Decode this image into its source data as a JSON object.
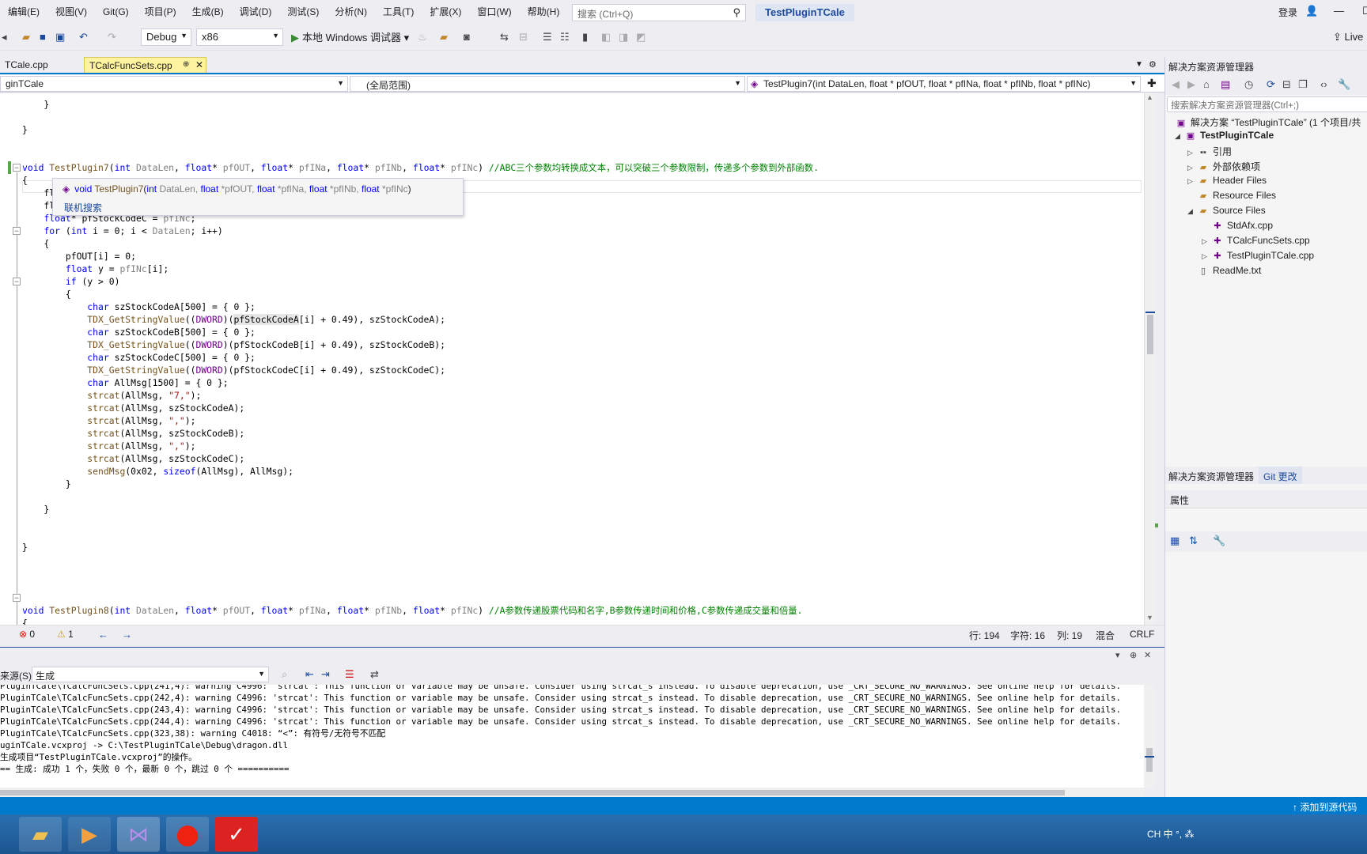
{
  "menu": [
    "编辑(E)",
    "视图(V)",
    "Git(G)",
    "项目(P)",
    "生成(B)",
    "调试(D)",
    "测试(S)",
    "分析(N)",
    "工具(T)",
    "扩展(X)",
    "窗口(W)",
    "帮助(H)"
  ],
  "search": {
    "placeholder": "搜索 (Ctrl+Q)"
  },
  "solution_title": "TestPluginTCale",
  "login": "登录",
  "toolbar": {
    "config": "Debug",
    "platform": "x86",
    "run_label": "本地 Windows 调试器",
    "live_share": "Live"
  },
  "tabs": [
    {
      "label": "TCale.cpp"
    },
    {
      "label": "TCalcFuncSets.cpp"
    }
  ],
  "nav": {
    "project": "ginTCale",
    "scope": "(全局范围)",
    "member": "TestPlugin7(int DataLen, float * pfOUT, float * pfINa, float * pfINb, float * pfINc)"
  },
  "tooltip": {
    "ret": "void",
    "name": "TestPlugin7",
    "open": "(",
    "p1t": "int",
    "p1": " DataLen, ",
    "p2t": "float",
    "p2": " *pfOUT, ",
    "p3t": "float",
    "p3": " *pfINa, ",
    "p4t": "float",
    "p4": " *pfINb, ",
    "p5t": "float",
    "p5": " *pfINc",
    "close": ")",
    "link": "联机搜索"
  },
  "code": {
    "l1": "    }",
    "l2": "}",
    "p7": {
      "kw_void": "void",
      "name": " TestPlugin7",
      "open": "(",
      "t1": "int",
      "a1": " DataLen",
      "c1": ", ",
      "t2": "float",
      "s2": "* ",
      "a2": "pfOUT",
      "c2": ", ",
      "t3": "float",
      "s3": "* ",
      "a3": "pfINa",
      "c3": ", ",
      "t4": "float",
      "s4": "* ",
      "a4": "pfINb",
      "c4": ", ",
      "t5": "float",
      "s5": "* ",
      "a5": "pfINc",
      "close": ") ",
      "comment": "//ABC三个参数均转换成文本，可以突破三个参数限制，传递多个参数到外部函数."
    },
    "brace_open": "{",
    "fl1": "    fl",
    "fl2": "    fl",
    "decl_c": {
      "t": "float",
      "rest": "* pfStockCodeC = ",
      "arg": "pfINc",
      "end": ";"
    },
    "for": {
      "kw": "for",
      "a": " (",
      "t": "int",
      "b": " i = 0; i < ",
      "arg": "DataLen",
      "c": "; i++)"
    },
    "inner_open": "    {",
    "assign": {
      "a": "        pfOUT[i] = 0;"
    },
    "floaty": {
      "t": "float",
      "a": " y = ",
      "arg": "pfINc",
      "b": "[i];"
    },
    "ifline": {
      "kw": "if",
      "a": " (y > 0)"
    },
    "if_open": "        {",
    "char_a": {
      "t": "char",
      "a": " szStockCodeA[500] = { 0 };"
    },
    "tdx_a": {
      "fn": "TDX_GetStringValue",
      "a": "((",
      "mac": "DWORD",
      "b": ")(",
      "hl": "pfStockCodeA",
      "c": "[i] + 0.49), szStockCodeA);"
    },
    "char_b": {
      "t": "char",
      "a": " szStockCodeB[500] = { 0 };"
    },
    "tdx_b": {
      "fn": "TDX_GetStringValue",
      "a": "((",
      "mac": "DWORD",
      "b": ")(pfStockCodeB[i] + 0.49), szStockCodeB);"
    },
    "char_c": {
      "t": "char",
      "a": " szStockCodeC[500] = { 0 };"
    },
    "tdx_c": {
      "fn": "TDX_GetStringValue",
      "a": "((",
      "mac": "DWORD",
      "b": ")(pfStockCodeC[i] + 0.49), szStockCodeC);"
    },
    "char_all": {
      "t": "char",
      "a": " AllMsg[1500] = { 0 };"
    },
    "strcat1": {
      "fn": "strcat",
      "a": "(AllMsg, ",
      "s": "\"7,\"",
      "b": ");"
    },
    "strcat2": {
      "fn": "strcat",
      "a": "(AllMsg, szStockCodeA);"
    },
    "strcat3": {
      "fn": "strcat",
      "a": "(AllMsg, ",
      "s": "\",\"",
      "b": ");"
    },
    "strcat4": {
      "fn": "strcat",
      "a": "(AllMsg, szStockCodeB);"
    },
    "strcat5": {
      "fn": "strcat",
      "a": "(AllMsg, ",
      "s": "\",\"",
      "b": ");"
    },
    "strcat6": {
      "fn": "strcat",
      "a": "(AllMsg, szStockCodeC);"
    },
    "send": {
      "fn": "sendMsg",
      "a": "(0x02, ",
      "kw": "sizeof",
      "b": "(AllMsg), AllMsg);"
    },
    "if_close": "        }",
    "for_close": "    }",
    "fn_close": "}",
    "p8": {
      "kw_void": "void",
      "name": " TestPlugin8",
      "open": "(",
      "t1": "int",
      "a1": " DataLen",
      "c1": ", ",
      "t2": "float",
      "s2": "* ",
      "a2": "pfOUT",
      "c2": ", ",
      "t3": "float",
      "s3": "* ",
      "a3": "pfINa",
      "c3": ", ",
      "t4": "float",
      "s4": "* ",
      "a4": "pfINb",
      "c4": ", ",
      "t5": "float",
      "s5": "* ",
      "a5": "pfINc",
      "close": ") ",
      "comment": "//A参数传递股票代码和名字,B参数传递时间和价格,C参数传递成交量和倍量."
    },
    "p8_open": "{"
  },
  "editor_status": {
    "errors": "0",
    "warnings": "1",
    "line": "行: 194",
    "char": "字符: 16",
    "col": "列: 19",
    "mode": "混合",
    "eol": "CRLF"
  },
  "output": {
    "source_label": "来源(S):",
    "source_value": "生成",
    "lines": [
      "PluginTCale\\TCalcFuncSets.cpp(241,4): warning C4996: 'strcat': This function or variable may be unsafe. Consider using strcat_s instead. To disable deprecation, use _CRT_SECURE_NO_WARNINGS. See online help for details.",
      "PluginTCale\\TCalcFuncSets.cpp(242,4): warning C4996: 'strcat': This function or variable may be unsafe. Consider using strcat_s instead. To disable deprecation, use _CRT_SECURE_NO_WARNINGS. See online help for details.",
      "PluginTCale\\TCalcFuncSets.cpp(243,4): warning C4996: 'strcat': This function or variable may be unsafe. Consider using strcat_s instead. To disable deprecation, use _CRT_SECURE_NO_WARNINGS. See online help for details.",
      "PluginTCale\\TCalcFuncSets.cpp(244,4): warning C4996: 'strcat': This function or variable may be unsafe. Consider using strcat_s instead. To disable deprecation, use _CRT_SECURE_NO_WARNINGS. See online help for details.",
      "PluginTCale\\TCalcFuncSets.cpp(323,38): warning C4018: “<”: 有符号/无符号不匹配",
      "uginTCale.vcxproj -> C:\\TestPluginTCale\\Debug\\dragon.dll",
      "生成项目“TestPluginTCale.vcxproj”的操作。",
      "== 生成: 成功 1 个，失败 0 个，最新 0 个，跳过 0 个 =========="
    ]
  },
  "solution_explorer": {
    "title": "解决方案资源管理器",
    "search_placeholder": "搜索解决方案资源管理器(Ctrl+;)",
    "solution": "解决方案 “TestPluginTCale” (1 个项目/共",
    "project": "TestPluginTCale",
    "items": [
      "引用",
      "外部依赖项",
      "Header Files",
      "Resource Files",
      "Source Files",
      "StdAfx.cpp",
      "TCalcFuncSets.cpp",
      "TestPluginTCale.cpp",
      "ReadMe.txt"
    ],
    "tab_active": "解决方案资源管理器",
    "tab_git": "Git 更改"
  },
  "properties": {
    "title": "属性"
  },
  "bottom_status": {
    "add_source": "添加到源代码"
  },
  "tray": {
    "text": "CH 中 °, ⁂"
  }
}
